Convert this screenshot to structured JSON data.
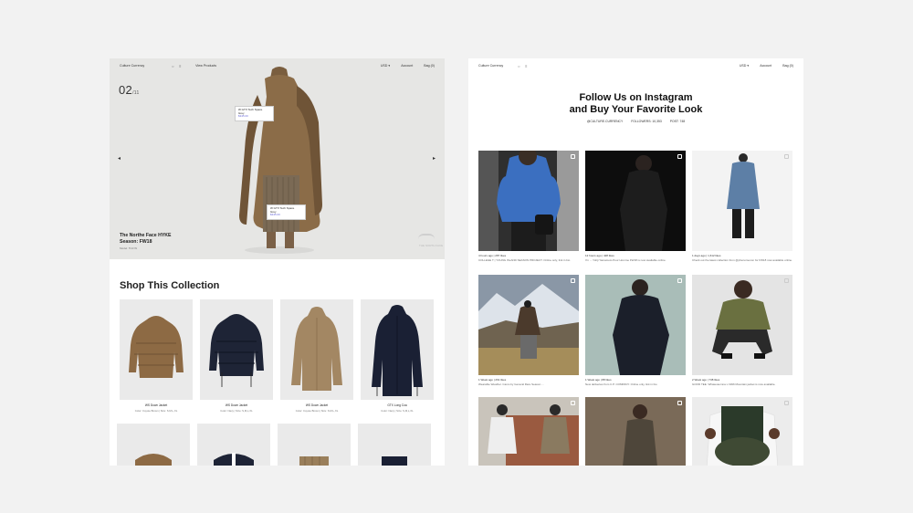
{
  "left_page": {
    "nav": {
      "brand": "Culture Currency",
      "search_icon": "search-icon",
      "menu_icon": "menu-icon",
      "link": "View Products",
      "currency": "USD ▾",
      "account": "Account",
      "bag": "Bag (0)"
    },
    "hero": {
      "slide_current": "02",
      "slide_total": "/11",
      "title_line1": "The Northe Face HYKE",
      "title_line2": "Season: FW18",
      "subtext": "Model: 5'10 W",
      "brand_mark": "THE NORTH FACE",
      "tag1": {
        "line1": "W GTX Tech Space",
        "line2": "Grey",
        "price": "$345.00"
      },
      "tag2": {
        "line1": "W GTX Tech Space",
        "line2": "Grey",
        "price": "$345.00"
      }
    },
    "shop": {
      "title": "Shop This Collection",
      "products": [
        {
          "name": "WS Down Jacket",
          "meta": "Color: Coyote Brown | Size: S,M,L,XL"
        },
        {
          "name": "WS Down Jacket",
          "meta": "Color: Navy | Size: S,M,L,XL"
        },
        {
          "name": "WS Down Jacket",
          "meta": "Color: Coyote Brown | Size: S,M,L,XL"
        },
        {
          "name": "GTX Long Coa",
          "meta": "Color: Navy | Size: S,M,L,XL"
        }
      ]
    }
  },
  "right_page": {
    "nav": {
      "brand": "Culture Currency",
      "currency": "USD ▾",
      "account": "Account",
      "bag": "Bag (0)"
    },
    "title_line1": "Follow Us on Instagram",
    "title_line2": "and Buy Your Favorite Look",
    "stats": [
      "@CULTURE.CURRENCY",
      "FOLLOWERS: 10,353",
      "POST: 748"
    ],
    "posts": [
      {
        "likes": "4 hours ago | 287 likes",
        "caption": "COLLEGE T | YOUNG ISLAND SEASON PROJECT. Online only, link in bio"
      },
      {
        "likes": "12 hours ago | 428 likes",
        "caption": "I'm ... Yohji Yamamoto Pour Homme FW18 is now available online."
      },
      {
        "likes": "1 days ago | 1,612 likes",
        "caption": "Check out the latest collection from @phenomenon for FW18 now available online."
      },
      {
        "likes": "1 Week ago | 261 likes",
        "caption": "Wearable Weather. Camo by General Rare Season ..."
      },
      {
        "likes": "1 Week ago | 88 likes",
        "caption": "New deliveries from C.P. COMPANY. Online only, link in bio"
      },
      {
        "likes": "2 Week ago | 738 likes",
        "caption": "GOOD TEE. Whatevaomna x 1996 Mountain jacket is now available."
      },
      {
        "likes": "",
        "caption": ""
      },
      {
        "likes": "",
        "caption": ""
      },
      {
        "likes": "",
        "caption": ""
      }
    ]
  }
}
